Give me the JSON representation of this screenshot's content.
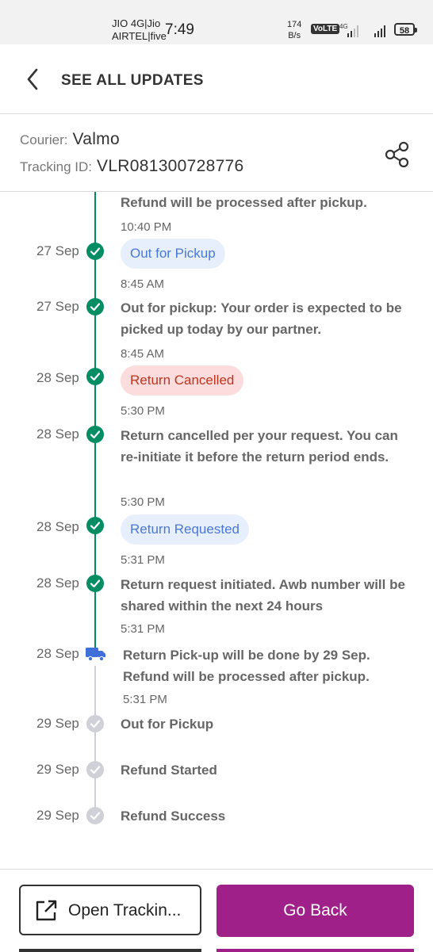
{
  "status_bar": {
    "carrier_line1": "JIO 4G|Jio",
    "carrier_line2": "AIRTEL|five",
    "time": "7:49",
    "speed_value": "174",
    "speed_unit": "B/s",
    "volte": "VoLTE",
    "network": "4G",
    "battery": "58"
  },
  "header": {
    "title": "SEE ALL UPDATES",
    "back_icon": "chevron-left-icon"
  },
  "courier": {
    "courier_label": "Courier:",
    "courier_value": "Valmo",
    "tracking_label": "Tracking ID:",
    "tracking_value": "VLR081300728776",
    "share_icon": "share-icon"
  },
  "timeline": {
    "top_partial_text": "Refund will be processed after pickup.",
    "top_partial_time": "10:40 PM",
    "events": [
      {
        "date": "27 Sep",
        "chip": "Out for Pickup",
        "time": "8:45 AM"
      },
      {
        "date": "27 Sep",
        "text": "Out for pickup: Your order is expected to be picked up today by our partner.",
        "time": "8:45 AM"
      },
      {
        "date": "28 Sep",
        "chip": "Return Cancelled",
        "time": "5:30 PM"
      },
      {
        "date": "28 Sep",
        "text": "Return cancelled per your request. You can re-initiate it before the return period ends.",
        "time": "5:30 PM"
      },
      {
        "date": "28 Sep",
        "chip": "Return Requested",
        "time": "5:31 PM"
      },
      {
        "date": "28 Sep",
        "text": "Return request initiated. Awb number will be shared within the next 24 hours",
        "time": "5:31 PM"
      },
      {
        "date": "28 Sep",
        "text": "Return Pick-up will be done by 29 Sep. Refund will be processed after pickup.",
        "time": "5:31 PM"
      },
      {
        "date": "29 Sep",
        "text": "Out for Pickup"
      },
      {
        "date": "29 Sep",
        "text": "Refund Started"
      },
      {
        "date": "29 Sep",
        "text": "Refund Success"
      }
    ]
  },
  "footer": {
    "open_tracking_label": "Open Trackin...",
    "go_back_label": "Go Back",
    "external_link_icon": "external-link-icon"
  },
  "colors": {
    "accent": "#9f2089",
    "done": "#038d63",
    "pending": "#d0d0d8",
    "chip_blue_bg": "#e7effc",
    "chip_red_bg": "#fcdcdc",
    "truck": "#3f6fd8"
  }
}
